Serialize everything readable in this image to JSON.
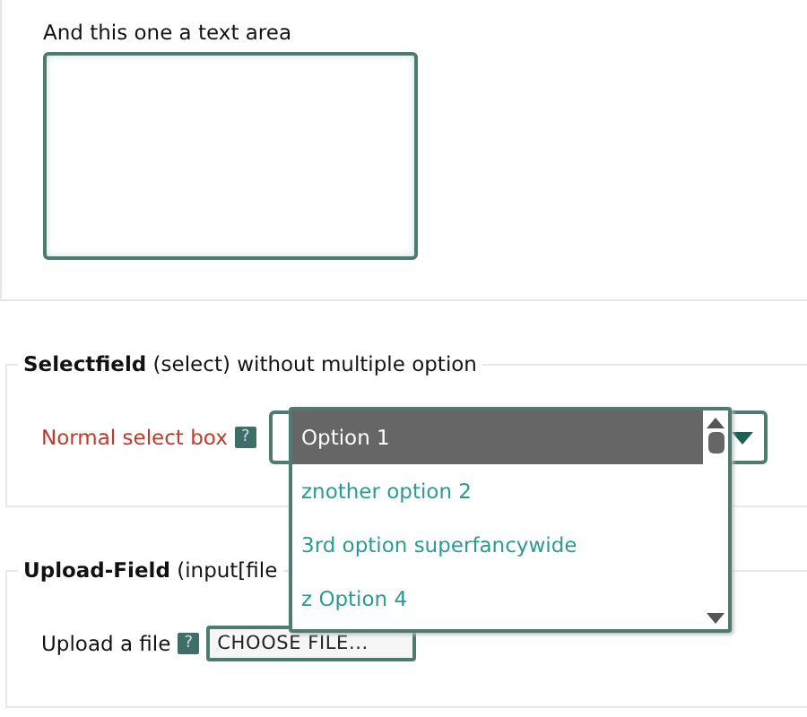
{
  "textarea_section": {
    "label": "And this one a text area"
  },
  "select_section": {
    "legend": "**Selectfield** (select) without multiple option",
    "field_label": "Normal select box",
    "help": "?",
    "options": [
      {
        "label": "Option 1",
        "selected": true
      },
      {
        "label": "znother option 2",
        "selected": false
      },
      {
        "label": "3rd option superfancywide",
        "selected": false
      },
      {
        "label": "z Option 4",
        "selected": false
      }
    ]
  },
  "upload_section": {
    "legend": "**Upload-Field** (input[file",
    "field_label": "Upload a file",
    "help": "?",
    "button": "CHOOSE FILE..."
  }
}
